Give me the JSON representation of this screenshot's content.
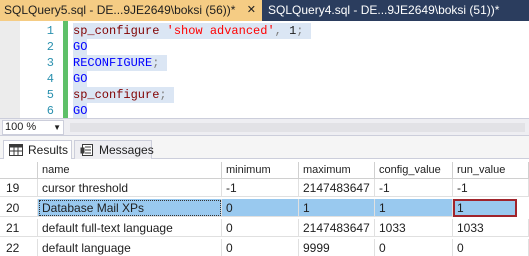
{
  "tabs": [
    {
      "label": "SQLQuery5.sql - DE...9JE2649\\boksi (56))*",
      "active": true
    },
    {
      "label": "SQLQuery4.sql - DE...9JE2649\\boksi (51))*",
      "active": false
    }
  ],
  "tab_close_glyph": "✕",
  "editor": {
    "line_numbers": [
      "1",
      "2",
      "3",
      "4",
      "5",
      "6"
    ],
    "lines": [
      {
        "t1": "sp_configure",
        "t2": "'show advanced'",
        "t3": ",",
        "t4": "1",
        "t5": ";"
      },
      {
        "t1": "GO"
      },
      {
        "t1": "RECONFIGURE",
        "t2": ";"
      },
      {
        "t1": "GO"
      },
      {
        "t1": "sp_configure",
        "t2": ";"
      },
      {
        "t1": "GO"
      }
    ]
  },
  "zoom": "100 %",
  "results_tabs": {
    "results": "Results",
    "messages": "Messages",
    "results_icon": "grid-icon",
    "messages_icon": "messages-icon"
  },
  "grid": {
    "columns": [
      "name",
      "minimum",
      "maximum",
      "config_value",
      "run_value"
    ],
    "rows": [
      {
        "num": "19",
        "name": "cursor threshold",
        "minimum": "-1",
        "maximum": "2147483647",
        "config_value": "-1",
        "run_value": "-1"
      },
      {
        "num": "20",
        "name": "Database Mail XPs",
        "minimum": "0",
        "maximum": "1",
        "config_value": "1",
        "run_value": "1"
      },
      {
        "num": "21",
        "name": "default full-text language",
        "minimum": "0",
        "maximum": "2147483647",
        "config_value": "1033",
        "run_value": "1033"
      },
      {
        "num": "22",
        "name": "default language",
        "minimum": "0",
        "maximum": "9999",
        "config_value": "0",
        "run_value": "0"
      }
    ],
    "selected_row": "20"
  },
  "colors": {
    "active_tab": "#f5cc84",
    "tabstrip": "#2b3d5e",
    "keyword": "#0000ff",
    "system_proc": "#800000",
    "string": "#ff0000",
    "selection": "#99c9ef",
    "focus_border": "#a0242c"
  }
}
